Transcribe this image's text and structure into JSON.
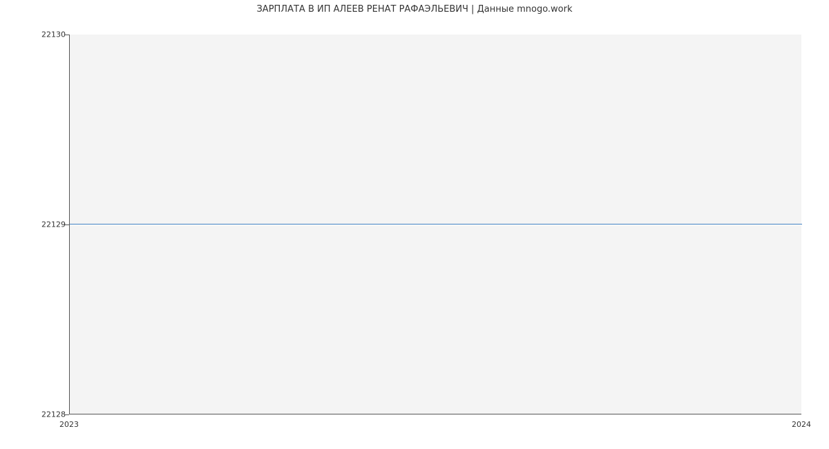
{
  "chart_data": {
    "type": "line",
    "title": "ЗАРПЛАТА В ИП АЛЕЕВ РЕНАТ РАФАЭЛЬЕВИЧ | Данные mnogo.work",
    "xlabel": "",
    "ylabel": "",
    "x": [
      "2023",
      "2024"
    ],
    "y": [
      22129,
      22129
    ],
    "ylim": [
      22128,
      22130
    ],
    "yticks": [
      22128,
      22129,
      22130
    ],
    "xticks": [
      "2023",
      "2024"
    ],
    "line_color": "#3f7fbf",
    "grid": true
  },
  "title": "ЗАРПЛАТА В ИП АЛЕЕВ РЕНАТ РАФАЭЛЬЕВИЧ | Данные mnogo.work",
  "yticks": {
    "t0": "22128",
    "t1": "22129",
    "t2": "22130"
  },
  "xticks": {
    "x0": "2023",
    "x1": "2024"
  }
}
